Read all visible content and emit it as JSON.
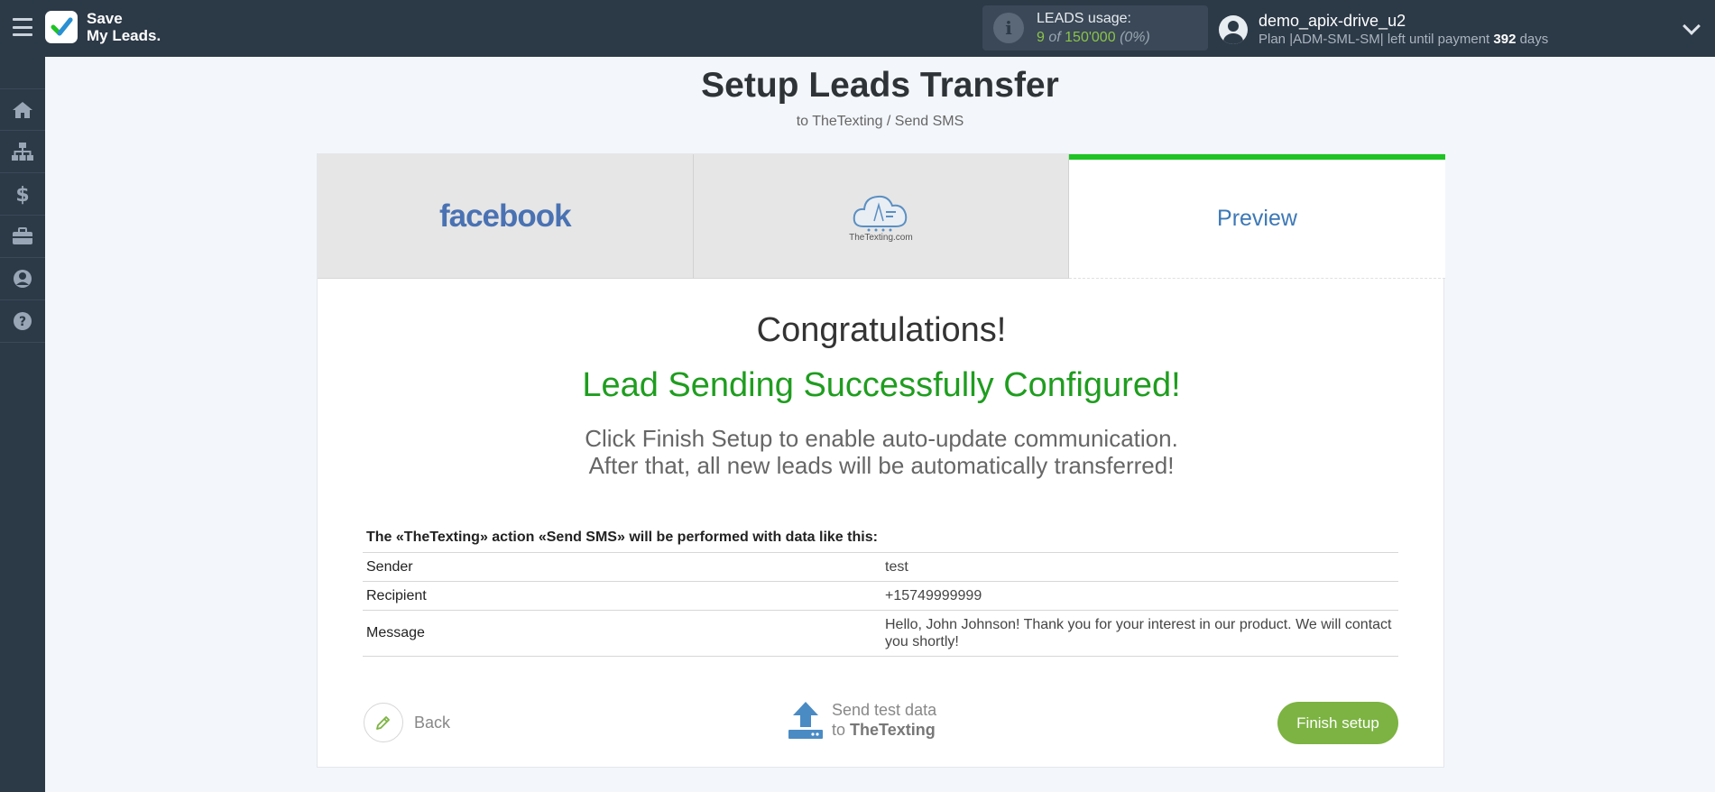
{
  "topbar": {
    "logo_line1": "Save",
    "logo_line2": "My Leads.",
    "usage_label": "LEADS usage:",
    "usage_used": "9",
    "usage_of": "of",
    "usage_total": "150'000",
    "usage_pct": "(0%)",
    "user_name": "demo_apix-drive_u2",
    "plan_prefix": "Plan |ADM-SML-SM| left until payment",
    "plan_days": "392",
    "plan_suffix": "days"
  },
  "sidebar": {
    "items": [
      {
        "icon": "home-icon"
      },
      {
        "icon": "sitemap-icon"
      },
      {
        "icon": "dollar-icon"
      },
      {
        "icon": "briefcase-icon"
      },
      {
        "icon": "user-icon"
      },
      {
        "icon": "help-icon"
      }
    ]
  },
  "header": {
    "title": "Setup Leads Transfer",
    "subtitle": "to TheTexting / Send SMS"
  },
  "tabs": [
    {
      "label": "facebook"
    },
    {
      "label": "TheTexting.com"
    },
    {
      "label": "Preview"
    }
  ],
  "main": {
    "congrats": "Congratulations!",
    "success": "Lead Sending Successfully Configured!",
    "info_line1": "Click Finish Setup to enable auto-update communication.",
    "info_line2": "After that, all new leads will be automatically transferred!",
    "table_title": "The «TheTexting» action «Send SMS» will be performed with data like this:",
    "rows": [
      {
        "key": "Sender",
        "value": "test"
      },
      {
        "key": "Recipient",
        "value": "+15749999999"
      },
      {
        "key": "Message",
        "value": "Hello, John Johnson! Thank you for your interest in our product. We will contact you shortly!"
      }
    ]
  },
  "actions": {
    "back": "Back",
    "send_line1": "Send test data",
    "send_to": "to",
    "send_target": "TheTexting",
    "finish": "Finish setup"
  },
  "colors": {
    "accent_green": "#1fc323",
    "success_green": "#1f9d1f",
    "button_green": "#7cb342",
    "nav_bg": "#2c3947"
  }
}
